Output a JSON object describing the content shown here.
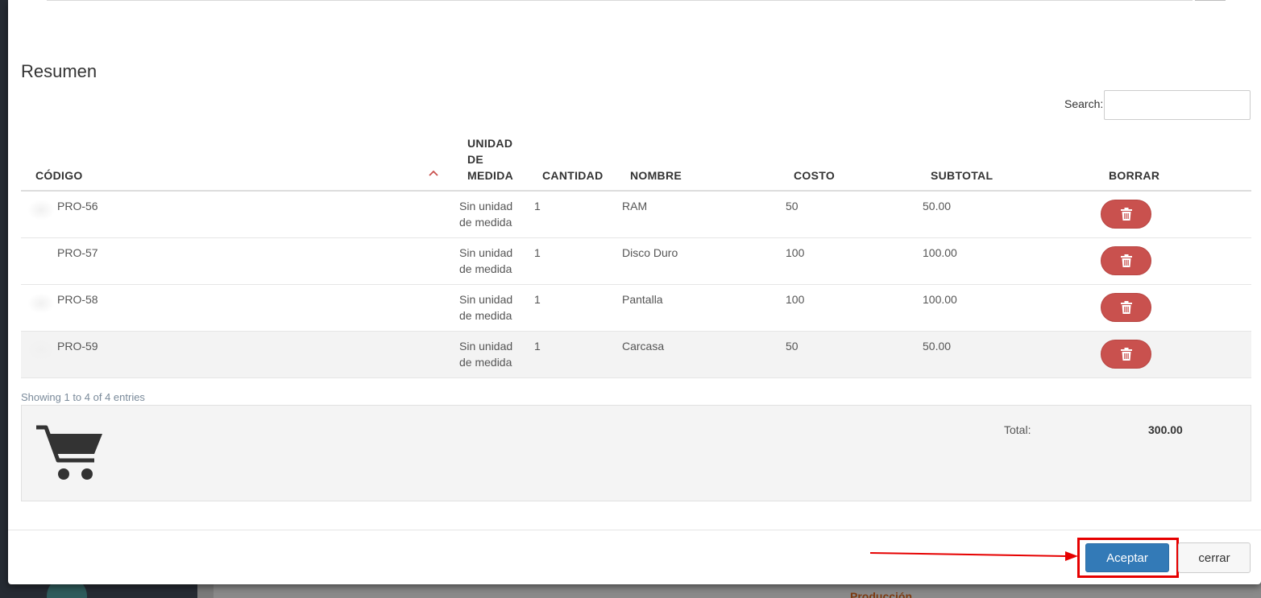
{
  "section": {
    "title": "Resumen"
  },
  "search": {
    "label": "Search:",
    "value": ""
  },
  "table": {
    "headers": {
      "codigo": "CÓDIGO",
      "unidad_line1": "UNIDAD",
      "unidad_line2": "DE",
      "unidad_line3": "MEDIDA",
      "cantidad": "CANTIDAD",
      "nombre": "NOMBRE",
      "costo": "COSTO",
      "subtotal": "SUBTOTAL",
      "borrar": "BORRAR"
    },
    "rows": [
      {
        "codigo": "PRO-56",
        "unidad_l1": "Sin unidad",
        "unidad_l2": "de medida",
        "cantidad": "1",
        "nombre": "RAM",
        "costo": "50",
        "subtotal": "50.00"
      },
      {
        "codigo": "PRO-57",
        "unidad_l1": "Sin unidad",
        "unidad_l2": "de medida",
        "cantidad": "1",
        "nombre": "Disco Duro",
        "costo": "100",
        "subtotal": "100.00"
      },
      {
        "codigo": "PRO-58",
        "unidad_l1": "Sin unidad",
        "unidad_l2": "de medida",
        "cantidad": "1",
        "nombre": "Pantalla",
        "costo": "100",
        "subtotal": "100.00"
      },
      {
        "codigo": "PRO-59",
        "unidad_l1": "Sin unidad",
        "unidad_l2": "de medida",
        "cantidad": "1",
        "nombre": "Carcasa",
        "costo": "50",
        "subtotal": "50.00"
      }
    ],
    "info": "Showing 1 to 4 of 4 entries"
  },
  "summary": {
    "total_label": "Total:",
    "total_value": "300.00",
    "icon": "shopping-cart-icon"
  },
  "footer": {
    "accept_label": "Aceptar",
    "close_label": "cerrar"
  },
  "background": {
    "section_label": "Producción"
  },
  "colors": {
    "accent": "#337ab7",
    "danger": "#c9514e",
    "annotation": "#e60000"
  }
}
